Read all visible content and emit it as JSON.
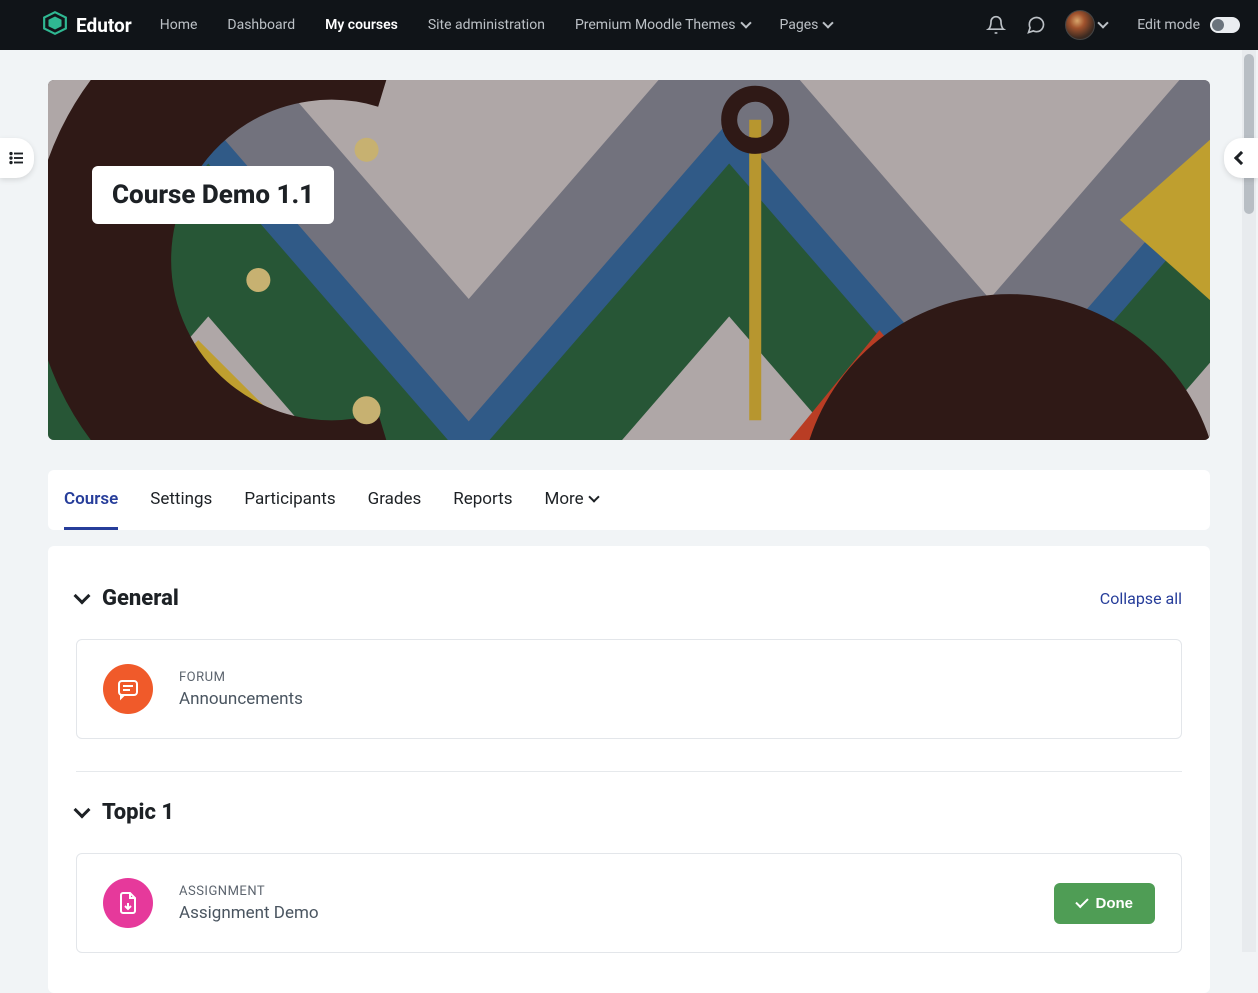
{
  "brand": {
    "name": "Edutor"
  },
  "nav": {
    "items": [
      {
        "label": "Home"
      },
      {
        "label": "Dashboard"
      },
      {
        "label": "My courses"
      },
      {
        "label": "Site administration"
      },
      {
        "label": "Premium Moodle Themes"
      },
      {
        "label": "Pages"
      }
    ],
    "active_index": 2
  },
  "edit_mode_label": "Edit mode",
  "course": {
    "title": "Course Demo 1.1"
  },
  "tabs": {
    "items": [
      {
        "label": "Course"
      },
      {
        "label": "Settings"
      },
      {
        "label": "Participants"
      },
      {
        "label": "Grades"
      },
      {
        "label": "Reports"
      },
      {
        "label": "More"
      }
    ],
    "active_index": 0
  },
  "collapse_all": "Collapse all",
  "sections": [
    {
      "title": "General",
      "activities": [
        {
          "type_label": "FORUM",
          "name": "Announcements",
          "icon": "forum"
        }
      ]
    },
    {
      "title": "Topic 1",
      "activities": [
        {
          "type_label": "ASSIGNMENT",
          "name": "Assignment Demo",
          "icon": "assignment",
          "done_label": "Done"
        }
      ]
    }
  ]
}
